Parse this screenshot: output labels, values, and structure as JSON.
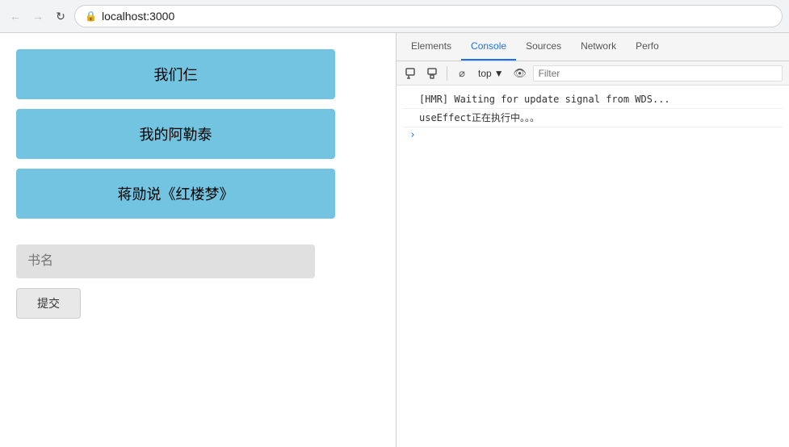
{
  "browser": {
    "back_disabled": true,
    "forward_disabled": true,
    "address": "localhost:3000",
    "lock_symbol": "🔒"
  },
  "page": {
    "buttons": [
      {
        "id": "btn-women",
        "label": "我们仨"
      },
      {
        "id": "btn-aletai",
        "label": "我的阿勒泰"
      },
      {
        "id": "btn-hongloumeng",
        "label": "蒋勋说《红楼梦》"
      }
    ],
    "input_placeholder": "书名",
    "submit_label": "提交"
  },
  "devtools": {
    "tabs": [
      {
        "id": "tab-elements",
        "label": "Elements",
        "active": false
      },
      {
        "id": "tab-console",
        "label": "Console",
        "active": true
      },
      {
        "id": "tab-sources",
        "label": "Sources",
        "active": false
      },
      {
        "id": "tab-network",
        "label": "Network",
        "active": false
      },
      {
        "id": "tab-perfo",
        "label": "Perfo",
        "active": false
      }
    ],
    "toolbar": {
      "context_label": "top",
      "filter_placeholder": "Filter"
    },
    "console_lines": [
      "[HMR] Waiting for update signal from WDS...",
      "useEffect正在执行中。。。"
    ],
    "icons": {
      "prohibit": "⊘",
      "eye": "👁",
      "inspect": "⬚",
      "device": "▭",
      "chevron_down": "▾",
      "chevron_right": "›"
    }
  }
}
